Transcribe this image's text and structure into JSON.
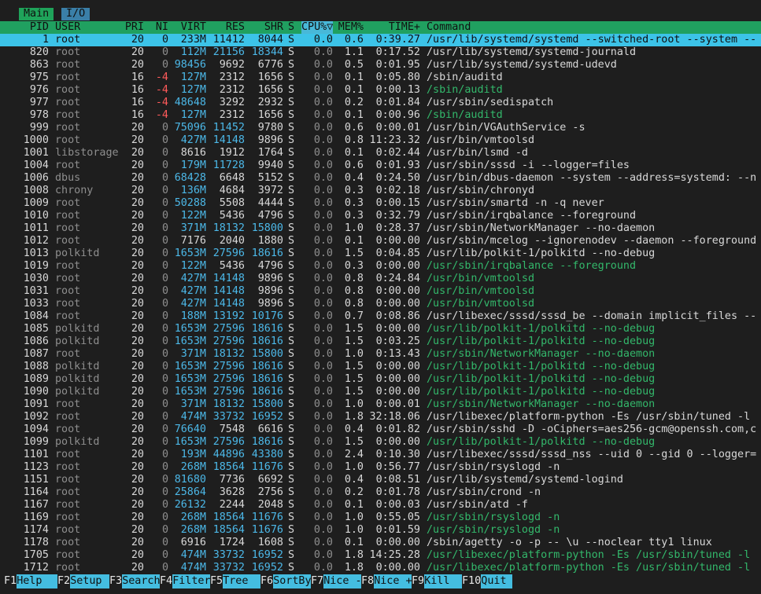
{
  "tabs": [
    {
      "label": "Main",
      "active": true
    },
    {
      "label": "I/O",
      "active": false
    }
  ],
  "columns": [
    "PID",
    "USER",
    "PRI",
    "NI",
    "VIRT",
    "RES",
    "SHR",
    "S",
    "CPU%▽",
    "MEM%",
    "TIME+",
    "Command"
  ],
  "sorted_column": "CPU%▽",
  "processes": [
    {
      "pid": "1",
      "user": "root",
      "pri": "20",
      "ni": "0",
      "virt": "233M",
      "res": "11412",
      "shr": "8044",
      "s": "S",
      "cpu": "0.0",
      "mem": "0.6",
      "time": "0:39.27",
      "cmd": "/usr/lib/systemd/systemd --switched-root --system --",
      "selected": true
    },
    {
      "pid": "820",
      "user": "root",
      "pri": "20",
      "ni": "0",
      "virt": "112M",
      "res": "21156",
      "shr": "18344",
      "s": "S",
      "cpu": "0.0",
      "mem": "1.1",
      "time": "0:17.52",
      "cmd": "/usr/lib/systemd/systemd-journald"
    },
    {
      "pid": "863",
      "user": "root",
      "pri": "20",
      "ni": "0",
      "virt": "98456",
      "res": "9692",
      "shr": "6776",
      "s": "S",
      "cpu": "0.0",
      "mem": "0.5",
      "time": "0:01.95",
      "cmd": "/usr/lib/systemd/systemd-udevd"
    },
    {
      "pid": "975",
      "user": "root",
      "pri": "16",
      "ni": "-4",
      "virt": "127M",
      "res": "2312",
      "shr": "1656",
      "s": "S",
      "cpu": "0.0",
      "mem": "0.1",
      "time": "0:05.80",
      "cmd": "/sbin/auditd"
    },
    {
      "pid": "976",
      "user": "root",
      "pri": "16",
      "ni": "-4",
      "virt": "127M",
      "res": "2312",
      "shr": "1656",
      "s": "S",
      "cpu": "0.0",
      "mem": "0.1",
      "time": "0:00.13",
      "cmd": "/sbin/auditd",
      "thread": true
    },
    {
      "pid": "977",
      "user": "root",
      "pri": "16",
      "ni": "-4",
      "virt": "48648",
      "res": "3292",
      "shr": "2932",
      "s": "S",
      "cpu": "0.0",
      "mem": "0.2",
      "time": "0:01.84",
      "cmd": "/usr/sbin/sedispatch"
    },
    {
      "pid": "978",
      "user": "root",
      "pri": "16",
      "ni": "-4",
      "virt": "127M",
      "res": "2312",
      "shr": "1656",
      "s": "S",
      "cpu": "0.0",
      "mem": "0.1",
      "time": "0:00.96",
      "cmd": "/sbin/auditd",
      "thread": true
    },
    {
      "pid": "999",
      "user": "root",
      "pri": "20",
      "ni": "0",
      "virt": "75096",
      "res": "11452",
      "shr": "9780",
      "s": "S",
      "cpu": "0.0",
      "mem": "0.6",
      "time": "0:00.01",
      "cmd": "/usr/bin/VGAuthService -s"
    },
    {
      "pid": "1000",
      "user": "root",
      "pri": "20",
      "ni": "0",
      "virt": "427M",
      "res": "14148",
      "shr": "9896",
      "s": "S",
      "cpu": "0.0",
      "mem": "0.8",
      "time": "11:23.32",
      "cmd": "/usr/bin/vmtoolsd"
    },
    {
      "pid": "1001",
      "user": "libstorage",
      "pri": "20",
      "ni": "0",
      "virt": "8616",
      "res": "1912",
      "shr": "1764",
      "s": "S",
      "cpu": "0.0",
      "mem": "0.1",
      "time": "0:02.44",
      "cmd": "/usr/bin/lsmd -d"
    },
    {
      "pid": "1004",
      "user": "root",
      "pri": "20",
      "ni": "0",
      "virt": "179M",
      "res": "11728",
      "shr": "9940",
      "s": "S",
      "cpu": "0.0",
      "mem": "0.6",
      "time": "0:01.93",
      "cmd": "/usr/sbin/sssd -i --logger=files"
    },
    {
      "pid": "1006",
      "user": "dbus",
      "pri": "20",
      "ni": "0",
      "virt": "68428",
      "res": "6648",
      "shr": "5152",
      "s": "S",
      "cpu": "0.0",
      "mem": "0.4",
      "time": "0:24.50",
      "cmd": "/usr/bin/dbus-daemon --system --address=systemd: --n"
    },
    {
      "pid": "1008",
      "user": "chrony",
      "pri": "20",
      "ni": "0",
      "virt": "136M",
      "res": "4684",
      "shr": "3972",
      "s": "S",
      "cpu": "0.0",
      "mem": "0.3",
      "time": "0:02.18",
      "cmd": "/usr/sbin/chronyd"
    },
    {
      "pid": "1009",
      "user": "root",
      "pri": "20",
      "ni": "0",
      "virt": "50288",
      "res": "5508",
      "shr": "4444",
      "s": "S",
      "cpu": "0.0",
      "mem": "0.3",
      "time": "0:00.15",
      "cmd": "/usr/sbin/smartd -n -q never"
    },
    {
      "pid": "1010",
      "user": "root",
      "pri": "20",
      "ni": "0",
      "virt": "122M",
      "res": "5436",
      "shr": "4796",
      "s": "S",
      "cpu": "0.0",
      "mem": "0.3",
      "time": "0:32.79",
      "cmd": "/usr/sbin/irqbalance --foreground"
    },
    {
      "pid": "1011",
      "user": "root",
      "pri": "20",
      "ni": "0",
      "virt": "371M",
      "res": "18132",
      "shr": "15800",
      "s": "S",
      "cpu": "0.0",
      "mem": "1.0",
      "time": "0:28.37",
      "cmd": "/usr/sbin/NetworkManager --no-daemon"
    },
    {
      "pid": "1012",
      "user": "root",
      "pri": "20",
      "ni": "0",
      "virt": "7176",
      "res": "2040",
      "shr": "1880",
      "s": "S",
      "cpu": "0.0",
      "mem": "0.1",
      "time": "0:00.00",
      "cmd": "/usr/sbin/mcelog --ignorenodev --daemon --foreground"
    },
    {
      "pid": "1013",
      "user": "polkitd",
      "pri": "20",
      "ni": "0",
      "virt": "1653M",
      "res": "27596",
      "shr": "18616",
      "s": "S",
      "cpu": "0.0",
      "mem": "1.5",
      "time": "0:04.85",
      "cmd": "/usr/lib/polkit-1/polkitd --no-debug"
    },
    {
      "pid": "1019",
      "user": "root",
      "pri": "20",
      "ni": "0",
      "virt": "122M",
      "res": "5436",
      "shr": "4796",
      "s": "S",
      "cpu": "0.0",
      "mem": "0.3",
      "time": "0:00.00",
      "cmd": "/usr/sbin/irqbalance --foreground",
      "thread": true
    },
    {
      "pid": "1030",
      "user": "root",
      "pri": "20",
      "ni": "0",
      "virt": "427M",
      "res": "14148",
      "shr": "9896",
      "s": "S",
      "cpu": "0.0",
      "mem": "0.8",
      "time": "0:24.84",
      "cmd": "/usr/bin/vmtoolsd",
      "thread": true
    },
    {
      "pid": "1031",
      "user": "root",
      "pri": "20",
      "ni": "0",
      "virt": "427M",
      "res": "14148",
      "shr": "9896",
      "s": "S",
      "cpu": "0.0",
      "mem": "0.8",
      "time": "0:00.00",
      "cmd": "/usr/bin/vmtoolsd",
      "thread": true
    },
    {
      "pid": "1033",
      "user": "root",
      "pri": "20",
      "ni": "0",
      "virt": "427M",
      "res": "14148",
      "shr": "9896",
      "s": "S",
      "cpu": "0.0",
      "mem": "0.8",
      "time": "0:00.00",
      "cmd": "/usr/bin/vmtoolsd",
      "thread": true
    },
    {
      "pid": "1084",
      "user": "root",
      "pri": "20",
      "ni": "0",
      "virt": "188M",
      "res": "13192",
      "shr": "10176",
      "s": "S",
      "cpu": "0.0",
      "mem": "0.7",
      "time": "0:08.86",
      "cmd": "/usr/libexec/sssd/sssd_be --domain implicit_files --"
    },
    {
      "pid": "1085",
      "user": "polkitd",
      "pri": "20",
      "ni": "0",
      "virt": "1653M",
      "res": "27596",
      "shr": "18616",
      "s": "S",
      "cpu": "0.0",
      "mem": "1.5",
      "time": "0:00.00",
      "cmd": "/usr/lib/polkit-1/polkitd --no-debug",
      "thread": true
    },
    {
      "pid": "1086",
      "user": "polkitd",
      "pri": "20",
      "ni": "0",
      "virt": "1653M",
      "res": "27596",
      "shr": "18616",
      "s": "S",
      "cpu": "0.0",
      "mem": "1.5",
      "time": "0:03.25",
      "cmd": "/usr/lib/polkit-1/polkitd --no-debug",
      "thread": true
    },
    {
      "pid": "1087",
      "user": "root",
      "pri": "20",
      "ni": "0",
      "virt": "371M",
      "res": "18132",
      "shr": "15800",
      "s": "S",
      "cpu": "0.0",
      "mem": "1.0",
      "time": "0:13.43",
      "cmd": "/usr/sbin/NetworkManager --no-daemon",
      "thread": true
    },
    {
      "pid": "1088",
      "user": "polkitd",
      "pri": "20",
      "ni": "0",
      "virt": "1653M",
      "res": "27596",
      "shr": "18616",
      "s": "S",
      "cpu": "0.0",
      "mem": "1.5",
      "time": "0:00.00",
      "cmd": "/usr/lib/polkit-1/polkitd --no-debug",
      "thread": true
    },
    {
      "pid": "1089",
      "user": "polkitd",
      "pri": "20",
      "ni": "0",
      "virt": "1653M",
      "res": "27596",
      "shr": "18616",
      "s": "S",
      "cpu": "0.0",
      "mem": "1.5",
      "time": "0:00.00",
      "cmd": "/usr/lib/polkit-1/polkitd --no-debug",
      "thread": true
    },
    {
      "pid": "1090",
      "user": "polkitd",
      "pri": "20",
      "ni": "0",
      "virt": "1653M",
      "res": "27596",
      "shr": "18616",
      "s": "S",
      "cpu": "0.0",
      "mem": "1.5",
      "time": "0:00.00",
      "cmd": "/usr/lib/polkit-1/polkitd --no-debug",
      "thread": true
    },
    {
      "pid": "1091",
      "user": "root",
      "pri": "20",
      "ni": "0",
      "virt": "371M",
      "res": "18132",
      "shr": "15800",
      "s": "S",
      "cpu": "0.0",
      "mem": "1.0",
      "time": "0:00.01",
      "cmd": "/usr/sbin/NetworkManager --no-daemon",
      "thread": true
    },
    {
      "pid": "1092",
      "user": "root",
      "pri": "20",
      "ni": "0",
      "virt": "474M",
      "res": "33732",
      "shr": "16952",
      "s": "S",
      "cpu": "0.0",
      "mem": "1.8",
      "time": "32:18.06",
      "cmd": "/usr/libexec/platform-python -Es /usr/sbin/tuned -l"
    },
    {
      "pid": "1094",
      "user": "root",
      "pri": "20",
      "ni": "0",
      "virt": "76640",
      "res": "7548",
      "shr": "6616",
      "s": "S",
      "cpu": "0.0",
      "mem": "0.4",
      "time": "0:01.82",
      "cmd": "/usr/sbin/sshd -D -oCiphers=aes256-gcm@openssh.com,c"
    },
    {
      "pid": "1099",
      "user": "polkitd",
      "pri": "20",
      "ni": "0",
      "virt": "1653M",
      "res": "27596",
      "shr": "18616",
      "s": "S",
      "cpu": "0.0",
      "mem": "1.5",
      "time": "0:00.00",
      "cmd": "/usr/lib/polkit-1/polkitd --no-debug",
      "thread": true
    },
    {
      "pid": "1101",
      "user": "root",
      "pri": "20",
      "ni": "0",
      "virt": "193M",
      "res": "44896",
      "shr": "43380",
      "s": "S",
      "cpu": "0.0",
      "mem": "2.4",
      "time": "0:10.30",
      "cmd": "/usr/libexec/sssd/sssd_nss --uid 0 --gid 0 --logger="
    },
    {
      "pid": "1123",
      "user": "root",
      "pri": "20",
      "ni": "0",
      "virt": "268M",
      "res": "18564",
      "shr": "11676",
      "s": "S",
      "cpu": "0.0",
      "mem": "1.0",
      "time": "0:56.77",
      "cmd": "/usr/sbin/rsyslogd -n"
    },
    {
      "pid": "1151",
      "user": "root",
      "pri": "20",
      "ni": "0",
      "virt": "81680",
      "res": "7736",
      "shr": "6692",
      "s": "S",
      "cpu": "0.0",
      "mem": "0.4",
      "time": "0:08.51",
      "cmd": "/usr/lib/systemd/systemd-logind"
    },
    {
      "pid": "1164",
      "user": "root",
      "pri": "20",
      "ni": "0",
      "virt": "25864",
      "res": "3628",
      "shr": "2756",
      "s": "S",
      "cpu": "0.0",
      "mem": "0.2",
      "time": "0:01.78",
      "cmd": "/usr/sbin/crond -n"
    },
    {
      "pid": "1167",
      "user": "root",
      "pri": "20",
      "ni": "0",
      "virt": "26132",
      "res": "2244",
      "shr": "2048",
      "s": "S",
      "cpu": "0.0",
      "mem": "0.1",
      "time": "0:00.03",
      "cmd": "/usr/sbin/atd -f"
    },
    {
      "pid": "1169",
      "user": "root",
      "pri": "20",
      "ni": "0",
      "virt": "268M",
      "res": "18564",
      "shr": "11676",
      "s": "S",
      "cpu": "0.0",
      "mem": "1.0",
      "time": "0:55.05",
      "cmd": "/usr/sbin/rsyslogd -n",
      "thread": true
    },
    {
      "pid": "1174",
      "user": "root",
      "pri": "20",
      "ni": "0",
      "virt": "268M",
      "res": "18564",
      "shr": "11676",
      "s": "S",
      "cpu": "0.0",
      "mem": "1.0",
      "time": "0:01.59",
      "cmd": "/usr/sbin/rsyslogd -n",
      "thread": true
    },
    {
      "pid": "1178",
      "user": "root",
      "pri": "20",
      "ni": "0",
      "virt": "6916",
      "res": "1724",
      "shr": "1608",
      "s": "S",
      "cpu": "0.0",
      "mem": "0.1",
      "time": "0:00.00",
      "cmd": "/sbin/agetty -o -p -- \\u --noclear tty1 linux"
    },
    {
      "pid": "1705",
      "user": "root",
      "pri": "20",
      "ni": "0",
      "virt": "474M",
      "res": "33732",
      "shr": "16952",
      "s": "S",
      "cpu": "0.0",
      "mem": "1.8",
      "time": "14:25.28",
      "cmd": "/usr/libexec/platform-python -Es /usr/sbin/tuned -l",
      "thread": true
    },
    {
      "pid": "1712",
      "user": "root",
      "pri": "20",
      "ni": "0",
      "virt": "474M",
      "res": "33732",
      "shr": "16952",
      "s": "S",
      "cpu": "0.0",
      "mem": "1.8",
      "time": "0:00.00",
      "cmd": "/usr/libexec/platform-python -Es /usr/sbin/tuned -l",
      "thread": true
    }
  ],
  "footer": [
    {
      "key": "F1",
      "label": "Help"
    },
    {
      "key": "F2",
      "label": "Setup"
    },
    {
      "key": "F3",
      "label": "Search"
    },
    {
      "key": "F4",
      "label": "Filter"
    },
    {
      "key": "F5",
      "label": "Tree"
    },
    {
      "key": "F6",
      "label": "SortBy"
    },
    {
      "key": "F7",
      "label": "Nice -"
    },
    {
      "key": "F8",
      "label": "Nice +"
    },
    {
      "key": "F9",
      "label": "Kill"
    },
    {
      "key": "F10",
      "label": "Quit"
    }
  ],
  "colors": {
    "header_bg": "#20a060",
    "selected_row_bg": "#3cc3e8",
    "thread_cmd": "#33b86b",
    "negative_nice": "#ff5a5a",
    "large_number": "#4cb8e8",
    "muted": "#8e8e8e"
  }
}
